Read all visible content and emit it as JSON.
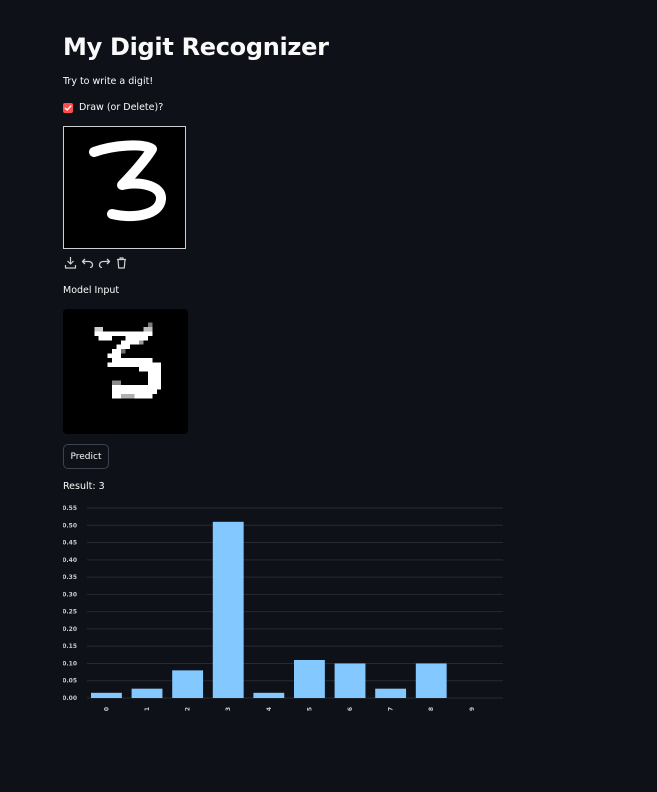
{
  "page": {
    "title": "My Digit Recognizer",
    "subtitle": "Try to write a digit!"
  },
  "draw_checkbox": {
    "label": "Draw (or Delete)?",
    "checked": true,
    "accent_color": "#ff4b4b"
  },
  "canvas_toolbar": {
    "icons": [
      "download-icon",
      "undo-icon",
      "redo-icon",
      "trash-icon"
    ]
  },
  "model_input": {
    "label": "Model Input"
  },
  "predict_button": {
    "label": "Predict"
  },
  "result": {
    "text": "Result: 3"
  },
  "chart_data": {
    "type": "bar",
    "categories": [
      "0",
      "1",
      "2",
      "3",
      "4",
      "5",
      "6",
      "7",
      "8",
      "9"
    ],
    "values": [
      0.015,
      0.027,
      0.08,
      0.51,
      0.015,
      0.11,
      0.1,
      0.027,
      0.1,
      0.0
    ],
    "ylim": [
      0,
      0.55
    ],
    "yticks": [
      "0.00",
      "0.05",
      "0.10",
      "0.15",
      "0.20",
      "0.25",
      "0.30",
      "0.35",
      "0.40",
      "0.45",
      "0.50",
      "0.55"
    ],
    "bar_color": "#83c9ff",
    "grid": true,
    "title": "",
    "xlabel": "",
    "ylabel": ""
  },
  "colors": {
    "background": "#0e1117",
    "text": "#fafafa",
    "gridline": "#262a33"
  }
}
